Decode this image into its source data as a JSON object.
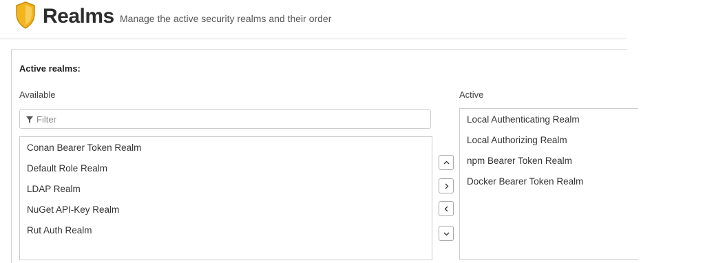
{
  "header": {
    "title": "Realms",
    "subtitle": "Manage the active security realms and their order",
    "icon": "shield-icon",
    "icon_color": "#f2b51d"
  },
  "panel": {
    "section_label": "Active realms:",
    "available": {
      "label": "Available",
      "filter_placeholder": "Filter",
      "filter_value": "",
      "items": [
        "Conan Bearer Token Realm",
        "Default Role Realm",
        "LDAP Realm",
        "NuGet API-Key Realm",
        "Rut Auth Realm"
      ]
    },
    "active": {
      "label": "Active",
      "items": [
        "Local Authenticating Realm",
        "Local Authorizing Realm",
        "npm Bearer Token Realm",
        "Docker Bearer Token Realm"
      ]
    },
    "buttons": {
      "move_up": "chevron-up-icon",
      "move_right": "chevron-right-icon",
      "move_left": "chevron-left-icon",
      "move_down": "chevron-down-icon"
    }
  }
}
